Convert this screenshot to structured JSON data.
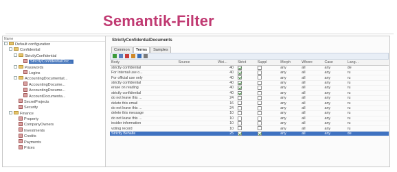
{
  "slide": {
    "title": "Semantik-Filter"
  },
  "tree": {
    "header": "Name",
    "nodes": [
      {
        "label": "Default configuration",
        "depth": 0,
        "icon": "config-icon",
        "selected": false
      },
      {
        "label": "Confidential",
        "depth": 1,
        "icon": "folder-icon",
        "selected": false
      },
      {
        "label": "StrictlyConfidential",
        "depth": 2,
        "icon": "folder-icon",
        "selected": false
      },
      {
        "label": "StrictlyConfidentialDoc...",
        "depth": 3,
        "icon": "document-icon",
        "selected": true
      },
      {
        "label": "Passwords",
        "depth": 2,
        "icon": "folder-icon",
        "selected": false
      },
      {
        "label": "Logins",
        "depth": 3,
        "icon": "document-icon",
        "selected": false
      },
      {
        "label": "AccountingDocumentat...",
        "depth": 2,
        "icon": "folder-icon",
        "selected": false
      },
      {
        "label": "AccountingDocume...",
        "depth": 3,
        "icon": "document-icon",
        "selected": false
      },
      {
        "label": "AccountingDocume...",
        "depth": 3,
        "icon": "document-icon",
        "selected": false
      },
      {
        "label": "AccountDocumenta...",
        "depth": 3,
        "icon": "document-icon",
        "selected": false
      },
      {
        "label": "SecretProjects",
        "depth": 2,
        "icon": "document-icon",
        "selected": false
      },
      {
        "label": "Security",
        "depth": 2,
        "icon": "document-icon",
        "selected": false
      },
      {
        "label": "Finance",
        "depth": 1,
        "icon": "folder-icon",
        "selected": false
      },
      {
        "label": "Property",
        "depth": 2,
        "icon": "document-icon",
        "selected": false
      },
      {
        "label": "CompanyOwners",
        "depth": 2,
        "icon": "document-icon",
        "selected": false
      },
      {
        "label": "Investments",
        "depth": 2,
        "icon": "document-icon",
        "selected": false
      },
      {
        "label": "Credits",
        "depth": 2,
        "icon": "document-icon",
        "selected": false
      },
      {
        "label": "Payments",
        "depth": 2,
        "icon": "document-icon",
        "selected": false
      },
      {
        "label": "Prices",
        "depth": 2,
        "icon": "document-icon",
        "selected": false
      }
    ]
  },
  "panel": {
    "title": "StrictlyConfidentialDocuments",
    "tabs": [
      {
        "label": "Common",
        "active": false
      },
      {
        "label": "Terms",
        "active": true
      },
      {
        "label": "Samples",
        "active": false
      }
    ],
    "toolbar_icons": [
      "add-icon",
      "edit-icon",
      "delete-icon",
      "undo-icon",
      "grid-icon",
      "import-icon"
    ],
    "columns": [
      "Body",
      "Source",
      "Wei...",
      "Strict",
      "Suppl",
      "Morph",
      "Where",
      "Case",
      "Lang..."
    ],
    "rows": [
      {
        "body": "strictly confidential",
        "source": "",
        "weight": "40",
        "strict": true,
        "suppl": false,
        "morph": "any",
        "where": "all",
        "case": "any",
        "lang": "de",
        "highlight": false
      },
      {
        "body": "For internal use o...",
        "source": "",
        "weight": "40",
        "strict": true,
        "suppl": false,
        "morph": "any",
        "where": "all",
        "case": "any",
        "lang": "ru",
        "highlight": false
      },
      {
        "body": "For official use only",
        "source": "",
        "weight": "40",
        "strict": true,
        "suppl": false,
        "morph": "any",
        "where": "all",
        "case": "any",
        "lang": "ru",
        "highlight": false
      },
      {
        "body": "strictly confidential",
        "source": "",
        "weight": "40",
        "strict": true,
        "suppl": false,
        "morph": "any",
        "where": "all",
        "case": "any",
        "lang": "ru",
        "highlight": false
      },
      {
        "body": "erase on reading",
        "source": "",
        "weight": "40",
        "strict": true,
        "suppl": false,
        "morph": "any",
        "where": "all",
        "case": "any",
        "lang": "ru",
        "highlight": false
      },
      {
        "body": "strictly confidential",
        "source": "",
        "weight": "40",
        "strict": true,
        "suppl": false,
        "morph": "any",
        "where": "all",
        "case": "any",
        "lang": "ru",
        "highlight": false
      },
      {
        "body": "do not leave this ...",
        "source": "",
        "weight": "24",
        "strict": false,
        "suppl": false,
        "morph": "any",
        "where": "all",
        "case": "any",
        "lang": "ru",
        "highlight": false
      },
      {
        "body": "delete this email",
        "source": "",
        "weight": "16",
        "strict": false,
        "suppl": false,
        "morph": "any",
        "where": "all",
        "case": "any",
        "lang": "ru",
        "highlight": false
      },
      {
        "body": "do not leave this ...",
        "source": "",
        "weight": "24",
        "strict": false,
        "suppl": false,
        "morph": "any",
        "where": "all",
        "case": "any",
        "lang": "ru",
        "highlight": false
      },
      {
        "body": "delete this message",
        "source": "",
        "weight": "10",
        "strict": false,
        "suppl": false,
        "morph": "any",
        "where": "all",
        "case": "any",
        "lang": "ru",
        "highlight": false
      },
      {
        "body": "do not leave this ...",
        "source": "",
        "weight": "10",
        "strict": false,
        "suppl": false,
        "morph": "any",
        "where": "all",
        "case": "any",
        "lang": "ru",
        "highlight": false
      },
      {
        "body": "insider information",
        "source": "",
        "weight": "10",
        "strict": false,
        "suppl": false,
        "morph": "any",
        "where": "all",
        "case": "any",
        "lang": "ru",
        "highlight": false
      },
      {
        "body": "voting record",
        "source": "",
        "weight": "10",
        "strict": false,
        "suppl": false,
        "morph": "any",
        "where": "all",
        "case": "any",
        "lang": "ru",
        "highlight": false
      },
      {
        "body": "Strictly Behalte",
        "source": "",
        "weight": "25",
        "strict": true,
        "suppl": true,
        "morph": "any",
        "where": "all",
        "case": "any",
        "lang": "de",
        "highlight": true
      }
    ]
  },
  "colors": {
    "title": "#c03a72",
    "selection": "#3f72c1"
  }
}
